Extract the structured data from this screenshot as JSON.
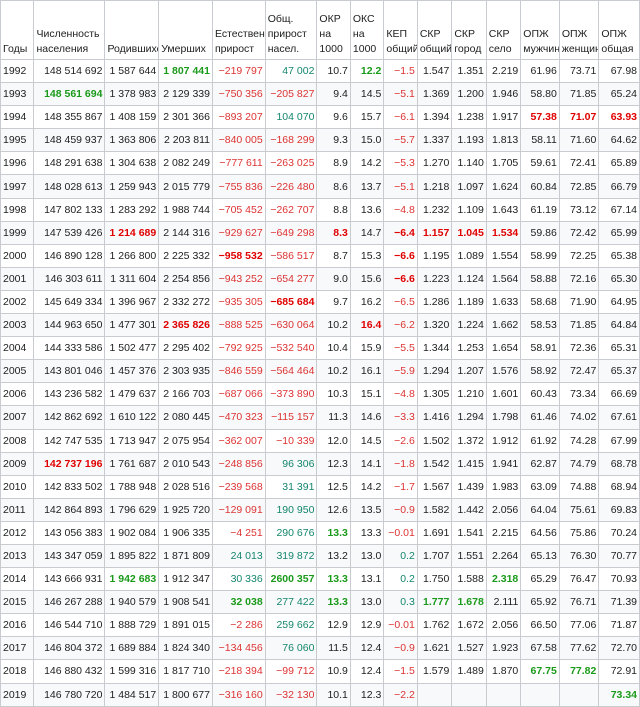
{
  "headers": [
    "Годы",
    "Численность населения",
    "Родившихся",
    "Умерших",
    "Естественный прирост",
    "Общ. прирост насел.",
    "ОКР на 1000",
    "ОКС на 1000",
    "КЕП общий",
    "СКР общий",
    "СКР город",
    "СКР село",
    "ОПЖ мужчин",
    "ОПЖ женщин",
    "ОПЖ общая"
  ],
  "header_lines": [
    [
      "Годы"
    ],
    [
      "Численность",
      "населения"
    ],
    [
      "Родившихся"
    ],
    [
      "Умерших"
    ],
    [
      "Естествен",
      "прирост"
    ],
    [
      "Общ.",
      "прирост",
      "насел."
    ],
    [
      "ОКР",
      "на",
      "1000"
    ],
    [
      "ОКС",
      "на",
      "1000"
    ],
    [
      "КЕП",
      "общий"
    ],
    [
      "СКР",
      "общий"
    ],
    [
      "СКР",
      "город"
    ],
    [
      "СКР",
      "село"
    ],
    [
      "ОПЖ",
      "мужчин"
    ],
    [
      "ОПЖ",
      "женщин"
    ],
    [
      "ОПЖ",
      "общая"
    ]
  ],
  "rows": [
    [
      "1992",
      "148 514 692",
      "1 587 644",
      "1 807 441",
      "−219 797",
      "47 002",
      "10.7",
      "12.2",
      "−1.5",
      "1.547",
      "1.351",
      "2.219",
      "61.96",
      "73.71",
      "67.98"
    ],
    [
      "1993",
      "148 561 694",
      "1 378 983",
      "2 129 339",
      "−750 356",
      "−205 827",
      "9.4",
      "14.5",
      "−5.1",
      "1.369",
      "1.200",
      "1.946",
      "58.80",
      "71.85",
      "65.24"
    ],
    [
      "1994",
      "148 355 867",
      "1 408 159",
      "2 301 366",
      "−893 207",
      "104 070",
      "9.6",
      "15.7",
      "−6.1",
      "1.394",
      "1.238",
      "1.917",
      "57.38",
      "71.07",
      "63.93"
    ],
    [
      "1995",
      "148 459 937",
      "1 363 806",
      "2 203 811",
      "−840 005",
      "−168 299",
      "9.3",
      "15.0",
      "−5.7",
      "1.337",
      "1.193",
      "1.813",
      "58.11",
      "71.60",
      "64.62"
    ],
    [
      "1996",
      "148 291 638",
      "1 304 638",
      "2 082 249",
      "−777 611",
      "−263 025",
      "8.9",
      "14.2",
      "−5.3",
      "1.270",
      "1.140",
      "1.705",
      "59.61",
      "72.41",
      "65.89"
    ],
    [
      "1997",
      "148 028 613",
      "1 259 943",
      "2 015 779",
      "−755 836",
      "−226 480",
      "8.6",
      "13.7",
      "−5.1",
      "1.218",
      "1.097",
      "1.624",
      "60.84",
      "72.85",
      "66.79"
    ],
    [
      "1998",
      "147 802 133",
      "1 283 292",
      "1 988 744",
      "−705 452",
      "−262 707",
      "8.8",
      "13.6",
      "−4.8",
      "1.232",
      "1.109",
      "1.643",
      "61.19",
      "73.12",
      "67.14"
    ],
    [
      "1999",
      "147 539 426",
      "1 214 689",
      "2 144 316",
      "−929 627",
      "−649 298",
      "8.3",
      "14.7",
      "−6.4",
      "1.157",
      "1.045",
      "1.534",
      "59.86",
      "72.42",
      "65.99"
    ],
    [
      "2000",
      "146 890 128",
      "1 266 800",
      "2 225 332",
      "−958 532",
      "−586 517",
      "8.7",
      "15.3",
      "−6.6",
      "1.195",
      "1.089",
      "1.554",
      "58.99",
      "72.25",
      "65.38"
    ],
    [
      "2001",
      "146 303 611",
      "1 311 604",
      "2 254 856",
      "−943 252",
      "−654 277",
      "9.0",
      "15.6",
      "−6.6",
      "1.223",
      "1.124",
      "1.564",
      "58.88",
      "72.16",
      "65.30"
    ],
    [
      "2002",
      "145 649 334",
      "1 396 967",
      "2 332 272",
      "−935 305",
      "−685 684",
      "9.7",
      "16.2",
      "−6.5",
      "1.286",
      "1.189",
      "1.633",
      "58.68",
      "71.90",
      "64.95"
    ],
    [
      "2003",
      "144 963 650",
      "1 477 301",
      "2 365 826",
      "−888 525",
      "−630 064",
      "10.2",
      "16.4",
      "−6.2",
      "1.320",
      "1.224",
      "1.662",
      "58.53",
      "71.85",
      "64.84"
    ],
    [
      "2004",
      "144 333 586",
      "1 502 477",
      "2 295 402",
      "−792 925",
      "−532 540",
      "10.4",
      "15.9",
      "−5.5",
      "1.344",
      "1.253",
      "1.654",
      "58.91",
      "72.36",
      "65.31"
    ],
    [
      "2005",
      "143 801 046",
      "1 457 376",
      "2 303 935",
      "−846 559",
      "−564 464",
      "10.2",
      "16.1",
      "−5.9",
      "1.294",
      "1.207",
      "1.576",
      "58.92",
      "72.47",
      "65.37"
    ],
    [
      "2006",
      "143 236 582",
      "1 479 637",
      "2 166 703",
      "−687 066",
      "−373 890",
      "10.3",
      "15.1",
      "−4.8",
      "1.305",
      "1.210",
      "1.601",
      "60.43",
      "73.34",
      "66.69"
    ],
    [
      "2007",
      "142 862 692",
      "1 610 122",
      "2 080 445",
      "−470 323",
      "−115 157",
      "11.3",
      "14.6",
      "−3.3",
      "1.416",
      "1.294",
      "1.798",
      "61.46",
      "74.02",
      "67.61"
    ],
    [
      "2008",
      "142 747 535",
      "1 713 947",
      "2 075 954",
      "−362 007",
      "−10 339",
      "12.0",
      "14.5",
      "−2.6",
      "1.502",
      "1.372",
      "1.912",
      "61.92",
      "74.28",
      "67.99"
    ],
    [
      "2009",
      "142 737 196",
      "1 761 687",
      "2 010 543",
      "−248 856",
      "96 306",
      "12.3",
      "14.1",
      "−1.8",
      "1.542",
      "1.415",
      "1.941",
      "62.87",
      "74.79",
      "68.78"
    ],
    [
      "2010",
      "142 833 502",
      "1 788 948",
      "2 028 516",
      "−239 568",
      "31 391",
      "12.5",
      "14.2",
      "−1.7",
      "1.567",
      "1.439",
      "1.983",
      "63.09",
      "74.88",
      "68.94"
    ],
    [
      "2011",
      "142 864 893",
      "1 796 629",
      "1 925 720",
      "−129 091",
      "190 950",
      "12.6",
      "13.5",
      "−0.9",
      "1.582",
      "1.442",
      "2.056",
      "64.04",
      "75.61",
      "69.83"
    ],
    [
      "2012",
      "143 056 383",
      "1 902 084",
      "1 906 335",
      "−4 251",
      "290 676",
      "13.3",
      "13.3",
      "−0.01",
      "1.691",
      "1.541",
      "2.215",
      "64.56",
      "75.86",
      "70.24"
    ],
    [
      "2013",
      "143 347 059",
      "1 895 822",
      "1 871 809",
      "24 013",
      "319 872",
      "13.2",
      "13.0",
      "0.2",
      "1.707",
      "1.551",
      "2.264",
      "65.13",
      "76.30",
      "70.77"
    ],
    [
      "2014",
      "143 666 931",
      "1 942 683",
      "1 912 347",
      "30 336",
      "2600 357",
      "13.3",
      "13.1",
      "0.2",
      "1.750",
      "1.588",
      "2.318",
      "65.29",
      "76.47",
      "70.93"
    ],
    [
      "2015",
      "146 267 288",
      "1 940 579",
      "1 908 541",
      "32 038",
      "277 422",
      "13.3",
      "13.0",
      "0.3",
      "1.777",
      "1.678",
      "2.111",
      "65.92",
      "76.71",
      "71.39"
    ],
    [
      "2016",
      "146 544 710",
      "1 888 729",
      "1 891 015",
      "−2 286",
      "259 662",
      "12.9",
      "12.9",
      "−0.01",
      "1.762",
      "1.672",
      "2.056",
      "66.50",
      "77.06",
      "71.87"
    ],
    [
      "2017",
      "146 804 372",
      "1 689 884",
      "1 824 340",
      "−134 456",
      "76 060",
      "11.5",
      "12.4",
      "−0.9",
      "1.621",
      "1.527",
      "1.923",
      "67.58",
      "77.62",
      "72.70"
    ],
    [
      "2018",
      "146 880 432",
      "1 599 316",
      "1 817 710",
      "−218 394",
      "−99 712",
      "10.9",
      "12.4",
      "−1.5",
      "1.579",
      "1.489",
      "1.870",
      "67.75",
      "77.82",
      "72.91"
    ],
    [
      "2019",
      "146 780 720",
      "1 484 517",
      "1 800 677",
      "−316 160",
      "−32 130",
      "10.1",
      "12.3",
      "−2.2",
      "",
      "",
      "",
      "",
      "",
      "73.34"
    ]
  ],
  "colors": {
    "negative": "#d33",
    "positive": "#14866d",
    "max_red": "#e00000",
    "max_green": "#1a9a1a"
  },
  "bold_red": [
    "1999:2",
    "2003:3",
    "2000:4",
    "2002:5",
    "1999:6",
    "2003:7",
    "1999:8",
    "2000:8",
    "2001:8",
    "1999:9",
    "1999:10",
    "1999:11",
    "1994:12",
    "1994:13",
    "1994:14",
    "2009:1"
  ],
  "bold_green": [
    "1993:1",
    "1992:3",
    "2014:2",
    "2015:4",
    "2014:5",
    "1992:7",
    "2012:6",
    "2014:6",
    "2015:6",
    "2015:9",
    "2015:10",
    "2014:11",
    "2018:12",
    "2018:13",
    "2019:14"
  ]
}
